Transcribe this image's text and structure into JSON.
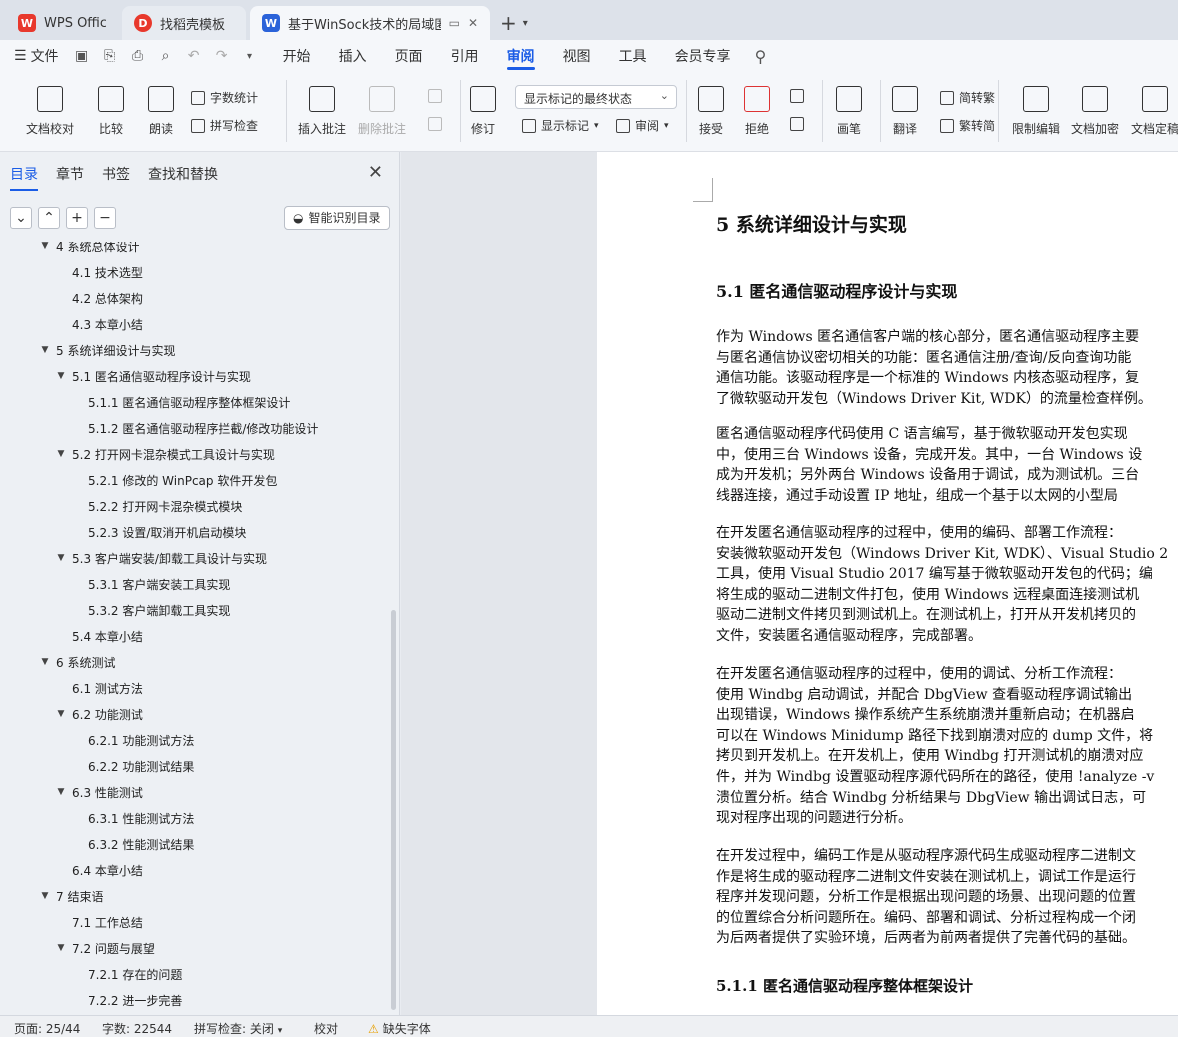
{
  "tabs": [
    {
      "label": "WPS Office",
      "icon": "wps-logo-icon"
    },
    {
      "label": "找稻壳模板",
      "icon": "docer-logo-icon"
    },
    {
      "label": "基于WinSock技术的局域匿职",
      "icon": "word-doc-icon"
    }
  ],
  "menu": {
    "file_label": "文件",
    "tabs": [
      "开始",
      "插入",
      "页面",
      "引用",
      "审阅",
      "视图",
      "工具",
      "会员专享"
    ],
    "active_tab": "审阅"
  },
  "ribbon": {
    "doc_proof": "文档校对",
    "compare": "比较",
    "read_aloud": "朗读",
    "word_count": "字数统计",
    "spell_check": "拼写检查",
    "insert_comment": "插入批注",
    "delete_comment": "删除批注",
    "revise": "修订",
    "markup_state": "显示标记的最终状态",
    "show_markup": "显示标记",
    "review_pane": "审阅",
    "accept": "接受",
    "reject": "拒绝",
    "pen": "画笔",
    "translate": "翻译",
    "to_traditional": "简转繁",
    "to_simplified": "繁转简",
    "restrict_edit": "限制编辑",
    "encrypt": "文档加密",
    "finalize": "文档定稿"
  },
  "nav": {
    "tabs": [
      "目录",
      "章节",
      "书签",
      "查找和替换"
    ],
    "active_tab": "目录",
    "smart_toc": "智能识别目录",
    "toc": [
      {
        "text": "4  系统总体设计",
        "level": 0,
        "expand": "open",
        "partial": true
      },
      {
        "text": "4.1  技术选型",
        "level": 1,
        "expand": "none"
      },
      {
        "text": "4.2  总体架构",
        "level": 1,
        "expand": "none"
      },
      {
        "text": "4.3  本章小结",
        "level": 1,
        "expand": "none"
      },
      {
        "text": "5  系统详细设计与实现",
        "level": 0,
        "expand": "open"
      },
      {
        "text": "5.1  匿名通信驱动程序设计与实现",
        "level": 1,
        "expand": "open"
      },
      {
        "text": "5.1.1  匿名通信驱动程序整体框架设计",
        "level": 2,
        "expand": "none"
      },
      {
        "text": "5.1.2  匿名通信驱动程序拦截/修改功能设计",
        "level": 2,
        "expand": "none"
      },
      {
        "text": "5.2  打开网卡混杂模式工具设计与实现",
        "level": 1,
        "expand": "open"
      },
      {
        "text": "5.2.1  修改的 WinPcap 软件开发包",
        "level": 2,
        "expand": "none"
      },
      {
        "text": "5.2.2  打开网卡混杂模式模块",
        "level": 2,
        "expand": "none"
      },
      {
        "text": "5.2.3  设置/取消开机启动模块",
        "level": 2,
        "expand": "none"
      },
      {
        "text": "5.3  客户端安装/卸载工具设计与实现",
        "level": 1,
        "expand": "open"
      },
      {
        "text": "5.3.1  客户端安装工具实现",
        "level": 2,
        "expand": "none"
      },
      {
        "text": "5.3.2  客户端卸载工具实现",
        "level": 2,
        "expand": "none"
      },
      {
        "text": "5.4  本章小结",
        "level": 1,
        "expand": "none"
      },
      {
        "text": "6  系统测试",
        "level": 0,
        "expand": "open"
      },
      {
        "text": "6.1  测试方法",
        "level": 1,
        "expand": "none"
      },
      {
        "text": "6.2  功能测试",
        "level": 1,
        "expand": "open"
      },
      {
        "text": "6.2.1  功能测试方法",
        "level": 2,
        "expand": "none"
      },
      {
        "text": "6.2.2  功能测试结果",
        "level": 2,
        "expand": "none"
      },
      {
        "text": "6.3  性能测试",
        "level": 1,
        "expand": "open"
      },
      {
        "text": "6.3.1  性能测试方法",
        "level": 2,
        "expand": "none"
      },
      {
        "text": "6.3.2  性能测试结果",
        "level": 2,
        "expand": "none"
      },
      {
        "text": "6.4  本章小结",
        "level": 1,
        "expand": "none"
      },
      {
        "text": "7  结束语",
        "level": 0,
        "expand": "open"
      },
      {
        "text": "7.1  工作总结",
        "level": 1,
        "expand": "none"
      },
      {
        "text": "7.2  问题与展望",
        "level": 1,
        "expand": "open"
      },
      {
        "text": "7.2.1  存在的问题",
        "level": 2,
        "expand": "none"
      },
      {
        "text": "7.2.2  进一步完善",
        "level": 2,
        "expand": "none"
      }
    ]
  },
  "doc": {
    "h1": "5  系统详细设计与实现",
    "h2": "5.1  匿名通信驱动程序设计与实现",
    "h3": "5.1.1  匿名通信驱动程序整体框架设计",
    "paragraphs": [
      [
        "作为 Windows 匿名通信客户端的核心部分，匿名通信驱动程序主要",
        "与匿名通信协议密切相关的功能：匿名通信注册/查询/反向查询功能",
        "通信功能。该驱动程序是一个标准的 Windows 内核态驱动程序，复",
        "了微软驱动开发包（Windows Driver Kit, WDK）的流量检查样例。"
      ],
      [
        "匿名通信驱动程序代码使用 C 语言编写，基于微软驱动开发包实现",
        "中，使用三台 Windows 设备，完成开发。其中，一台 Windows 设",
        "成为开发机；另外两台 Windows 设备用于调试，成为测试机。三台",
        "线器连接，通过手动设置 IP 地址，组成一个基于以太网的小型局"
      ],
      [
        "在开发匿名通信驱动程序的过程中，使用的编码、部署工作流程：",
        "安装微软驱动开发包（Windows Driver Kit, WDK）、Visual Studio 2",
        "工具，使用 Visual Studio 2017 编写基于微软驱动开发包的代码；编",
        "将生成的驱动二进制文件打包，使用 Windows 远程桌面连接测试机",
        "驱动二进制文件拷贝到测试机上。在测试机上，打开从开发机拷贝的",
        "文件，安装匿名通信驱动程序，完成部署。"
      ],
      [
        "在开发匿名通信驱动程序的过程中，使用的调试、分析工作流程：",
        "使用 Windbg 启动调试，并配合 DbgView 查看驱动程序调试输出",
        "出现错误，Windows 操作系统产生系统崩溃并重新启动；在机器启",
        "可以在 Windows Minidump 路径下找到崩溃对应的 dump 文件，将",
        "拷贝到开发机上。在开发机上，使用 Windbg 打开测试机的崩溃对应",
        "件，并为 Windbg 设置驱动程序源代码所在的路径，使用 !analyze -v",
        "溃位置分析。结合 Windbg 分析结果与 DbgView 输出调试日志，可",
        "现对程序出现的问题进行分析。"
      ],
      [
        "在开发过程中，编码工作是从驱动程序源代码生成驱动程序二进制文",
        "作是将生成的驱动程序二进制文件安装在测试机上，调试工作是运行",
        "程序并发现问题，分析工作是根据出现问题的场景、出现问题的位置",
        "的位置综合分析问题所在。编码、部署和调试、分析过程构成一个闭",
        "为后两者提供了实验环境，后两者为前两者提供了完善代码的基础。"
      ]
    ]
  },
  "status": {
    "page": "页面: 25/44",
    "words": "字数: 22544",
    "spell": "拼写检查: 关闭",
    "proof": "校对",
    "missing_font": "缺失字体"
  },
  "colors": {
    "accent": "#1a5ce6",
    "wps_red": "#e8382c",
    "word_blue": "#2b63d9"
  }
}
